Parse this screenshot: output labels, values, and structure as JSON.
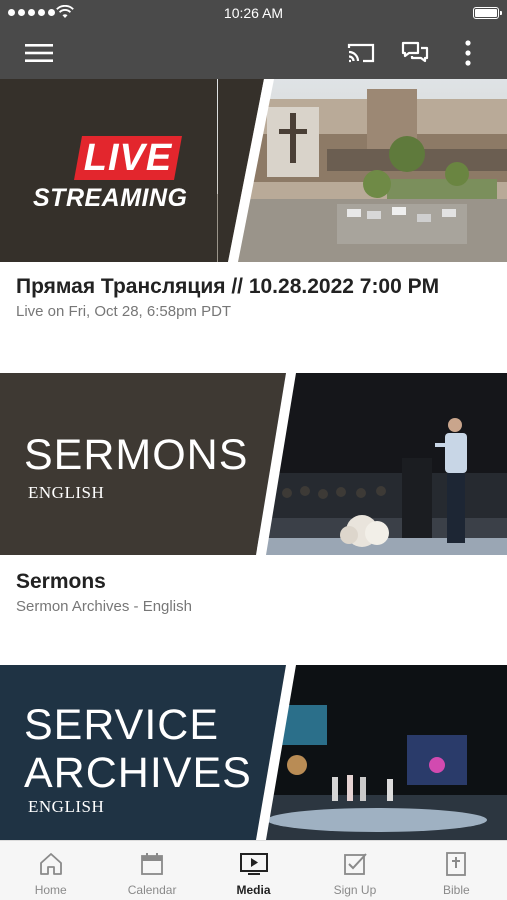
{
  "status_bar": {
    "time": "10:26 AM"
  },
  "app_bar": {
    "menu_icon": "hamburger-menu-icon",
    "cast_icon": "cast-icon",
    "chat_icon": "chat-bubbles-icon",
    "more_icon": "more-vertical-icon"
  },
  "cards": [
    {
      "banner": {
        "badge": "LIVE",
        "line2": "STREAMING"
      },
      "title": "Прямая Трансляция // 10.28.2022 7:00 PM",
      "subtitle": "Live on Fri, Oct 28, 6:58pm PDT"
    },
    {
      "banner": {
        "line1": "SERMONS",
        "line2": "ENGLISH"
      },
      "title": "Sermons",
      "subtitle": "Sermon Archives - English"
    },
    {
      "banner": {
        "line1": "SERVICE",
        "line1b": "ARCHIVES",
        "line2": "ENGLISH"
      }
    }
  ],
  "tabs": [
    {
      "label": "Home",
      "icon": "home-icon"
    },
    {
      "label": "Calendar",
      "icon": "calendar-icon"
    },
    {
      "label": "Media",
      "icon": "media-play-icon",
      "active": true
    },
    {
      "label": "Sign Up",
      "icon": "checkbox-icon"
    },
    {
      "label": "Bible",
      "icon": "bible-icon"
    }
  ],
  "colors": {
    "chrome": "#4a4a4a",
    "live_red": "#e3262d",
    "live_panel": "#35302a",
    "sermons_panel": "#3e3933",
    "archives_panel": "#1f3344",
    "tab_bar": "#f6f6f6"
  }
}
